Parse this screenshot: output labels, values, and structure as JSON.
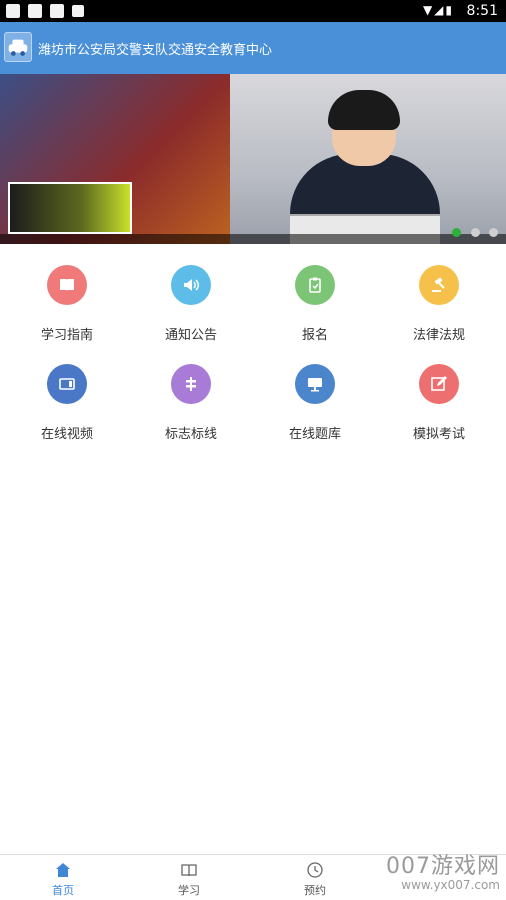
{
  "statusbar": {
    "time": "8:51",
    "signal_icons": "▼◢▮"
  },
  "app": {
    "title": "潍坊市公安局交警支队交通安全教育中心",
    "accent": "#4a90d9"
  },
  "banner": {
    "slides": 3,
    "active_slide": 1
  },
  "menu": [
    {
      "label": "学习指南",
      "icon": "book-icon",
      "color": "#f07a7a"
    },
    {
      "label": "通知公告",
      "icon": "speaker-icon",
      "color": "#5dbde8"
    },
    {
      "label": "报名",
      "icon": "clipboard-icon",
      "color": "#7cc576"
    },
    {
      "label": "法律法规",
      "icon": "gavel-icon",
      "color": "#f5c14a"
    },
    {
      "label": "在线视频",
      "icon": "tv-icon",
      "color": "#4b77c7"
    },
    {
      "label": "标志标线",
      "icon": "signpost-icon",
      "color": "#a87bd6"
    },
    {
      "label": "在线题库",
      "icon": "monitor-icon",
      "color": "#4b86cc"
    },
    {
      "label": "模拟考试",
      "icon": "edit-icon",
      "color": "#ee6f6f"
    }
  ],
  "tabs": [
    {
      "label": "首页",
      "icon": "home-icon",
      "active": true
    },
    {
      "label": "学习",
      "icon": "open-book-icon",
      "active": false
    },
    {
      "label": "预约",
      "icon": "clock-icon",
      "active": false
    },
    {
      "label": "",
      "icon": "",
      "active": false
    }
  ],
  "watermark": {
    "title": "007游戏网",
    "url": "www.yx007.com"
  }
}
